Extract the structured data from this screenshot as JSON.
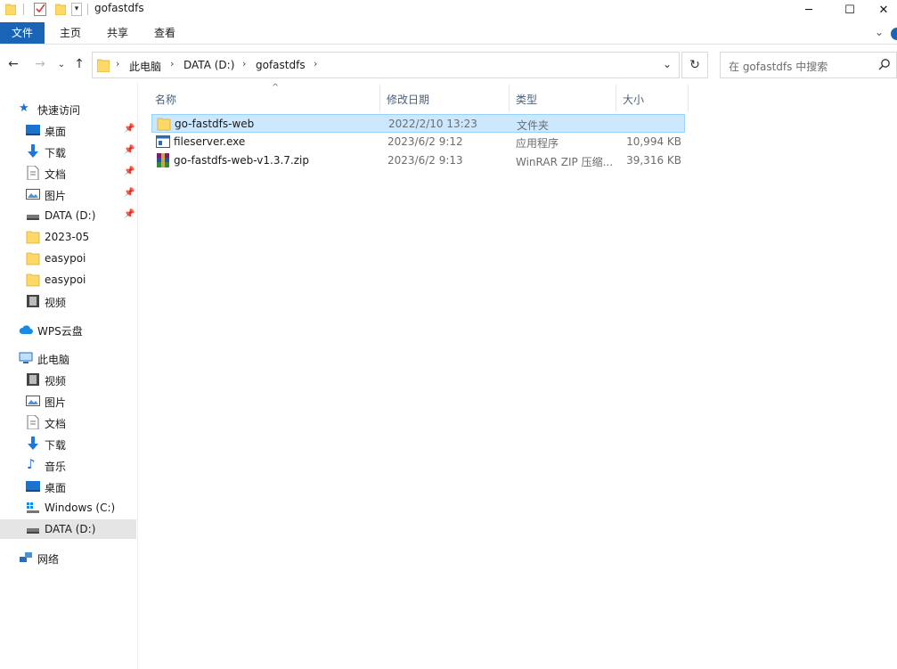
{
  "window": {
    "title": "gofastdfs",
    "minimize": "─",
    "maximize": "☐",
    "close": "✕"
  },
  "ribbon": {
    "tabs": [
      "文件",
      "主页",
      "共享",
      "查看"
    ],
    "expand_icon": "chevron-down",
    "help_icon": "help-icon"
  },
  "address": {
    "crumbs": [
      "此电脑",
      "DATA (D:)",
      "gofastdfs"
    ],
    "search_placeholder": "在 gofastdfs 中搜索"
  },
  "navpane": {
    "quick_access": "快速访问",
    "quick_items": [
      "桌面",
      "下载",
      "文档",
      "图片",
      "DATA (D:)",
      "2023-05",
      "easypoi",
      "easypoi",
      "视频"
    ],
    "wps": "WPS云盘",
    "this_pc": "此电脑",
    "pc_items": [
      "视频",
      "图片",
      "文档",
      "下载",
      "音乐",
      "桌面",
      "Windows (C:)",
      "DATA (D:)"
    ],
    "network": "网络"
  },
  "columns": {
    "name": "名称",
    "date": "修改日期",
    "type": "类型",
    "size": "大小"
  },
  "files": [
    {
      "name": "go-fastdfs-web",
      "date": "2022/2/10 13:23",
      "type": "文件夹",
      "size": "",
      "icon": "folder-icon"
    },
    {
      "name": "fileserver.exe",
      "date": "2023/6/2 9:12",
      "type": "应用程序",
      "size": "10,994 KB",
      "icon": "exe-icon"
    },
    {
      "name": "go-fastdfs-web-v1.3.7.zip",
      "date": "2023/6/2 9:13",
      "type": "WinRAR ZIP 压缩...",
      "size": "39,316 KB",
      "icon": "winrar-icon"
    }
  ],
  "colors": {
    "file_tab": "#1a64b8",
    "selection": "#cce8ff",
    "folder": "#ffd866"
  }
}
